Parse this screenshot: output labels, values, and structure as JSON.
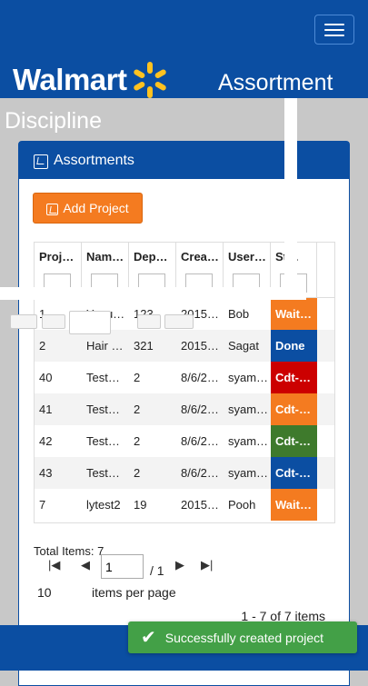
{
  "header": {
    "brand": "Walmart",
    "title_line1": "Assortment",
    "title_line2": "Discipline",
    "colors": {
      "header_bg": "#0b4ea2",
      "spark": "#ffc220"
    }
  },
  "panel": {
    "title": "Assortments",
    "add_button_label": "Add Project"
  },
  "grid": {
    "columns": [
      "Proj…",
      "Nam…",
      "Dep…",
      "Crea…",
      "User…",
      "St…"
    ],
    "rows": [
      {
        "project": "1",
        "name": "Yogu…",
        "dept": "123",
        "created": "2015…",
        "user": "Bob",
        "status": "Wait…",
        "status_color": "#f47b20"
      },
      {
        "project": "2",
        "name": "Hair …",
        "dept": "321",
        "created": "2015…",
        "user": "Sagat",
        "status": "Done",
        "status_color": "#0b4ea2"
      },
      {
        "project": "40",
        "name": "Test…",
        "dept": "2",
        "created": "8/6/2…",
        "user": "syam…",
        "status": "Cdt-…",
        "status_color": "#cc0000"
      },
      {
        "project": "41",
        "name": "Test…",
        "dept": "2",
        "created": "8/6/2…",
        "user": "syam…",
        "status": "Cdt-…",
        "status_color": "#f47b20"
      },
      {
        "project": "42",
        "name": "Test…",
        "dept": "2",
        "created": "8/6/2…",
        "user": "syam…",
        "status": "Cdt-…",
        "status_color": "#3e7a2c"
      },
      {
        "project": "43",
        "name": "Test…",
        "dept": "2",
        "created": "8/6/2…",
        "user": "syam…",
        "status": "Cdt-…",
        "status_color": "#0b4ea2"
      },
      {
        "project": "7",
        "name": "lytest2",
        "dept": "19",
        "created": "2015…",
        "user": "Pooh",
        "status": "Wait…",
        "status_color": "#f47b20"
      }
    ]
  },
  "footer": {
    "total_items": "Total Items: 7",
    "page_value": "1",
    "page_of": "/ 1",
    "items_per_page_value": "10",
    "items_per_page_label": "items per page",
    "range": "1 - 7 of 7 items"
  },
  "toast": {
    "message": "Successfully created project"
  }
}
